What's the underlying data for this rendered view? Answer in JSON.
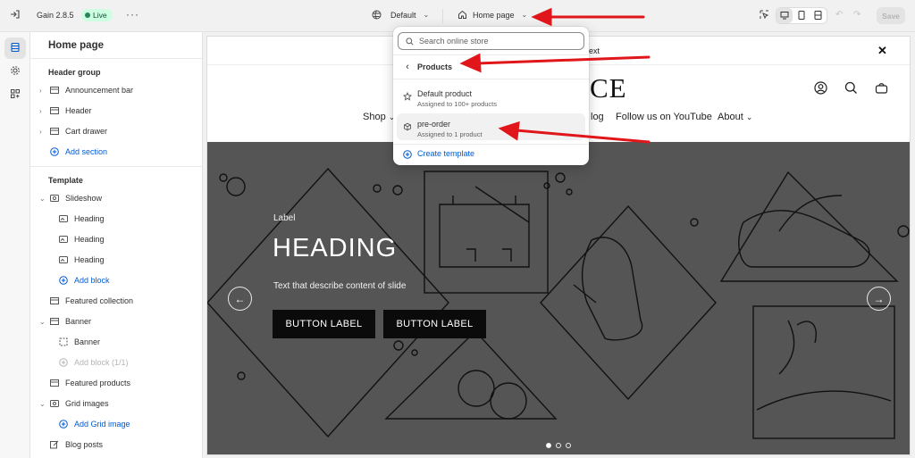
{
  "topbar": {
    "app_name": "Gain 2.8.5",
    "live_badge": "Live",
    "theme_selector": "Default",
    "page_selector": "Home page",
    "save_label": "Save"
  },
  "sidebar": {
    "title": "Home page",
    "header_group_label": "Header group",
    "header_items": [
      "Announcement bar",
      "Header",
      "Cart drawer"
    ],
    "add_section": "Add section",
    "template_label": "Template",
    "slideshow": "Slideshow",
    "slideshow_blocks": [
      "Heading",
      "Heading",
      "Heading"
    ],
    "add_block": "Add block",
    "featured_collection": "Featured collection",
    "banner": "Banner",
    "banner_block": "Banner",
    "add_block_disabled": "Add block (1/1)",
    "featured_products": "Featured products",
    "grid_images": "Grid images",
    "add_grid_image": "Add Grid image",
    "blog_posts": "Blog posts"
  },
  "dropdown": {
    "search_placeholder": "Search online store",
    "back_label": "Products",
    "items": [
      {
        "title": "Default product",
        "subtitle": "Assigned to 100+ products",
        "icon": "star-icon"
      },
      {
        "title": "pre-order",
        "subtitle": "Assigned to 1 product",
        "icon": "template-icon"
      }
    ],
    "create_template": "Create template"
  },
  "preview": {
    "announcement_fragment": "ext",
    "logo_fragment": "CE",
    "nav": [
      "Shop",
      "log",
      "Follow us on YouTube",
      "About"
    ],
    "slide_label": "Label",
    "slide_heading": "HEADING",
    "slide_text": "Text that describe content of slide",
    "button_1": "BUTTON LABEL",
    "button_2": "BUTTON LABEL"
  },
  "colors": {
    "accent_blue": "#005bd3",
    "live_green": "#29845a",
    "annotation_red": "#e0161b",
    "hero_bg": "#555555"
  }
}
